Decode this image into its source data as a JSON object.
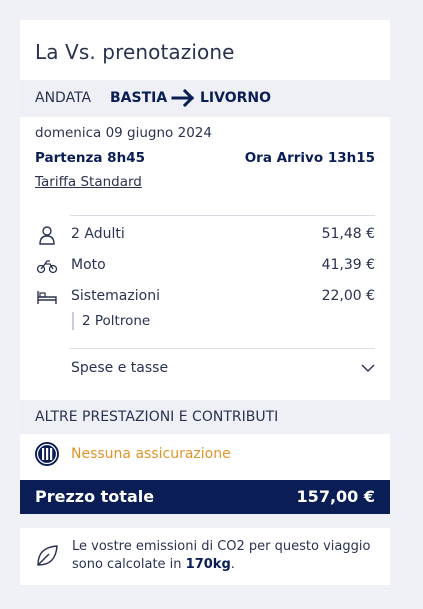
{
  "booking": {
    "title": "La Vs. prenotazione",
    "direction": "ANDATA",
    "from": "BASTIA",
    "to": "LIVORNO",
    "date": "domenica 09 giugno 2024",
    "departure": "Partenza 8h45",
    "arrival": "Ora Arrivo 13h15",
    "fare": "Tariffa Standard"
  },
  "items": [
    {
      "icon": "person-icon",
      "label": "2 Adulti",
      "price": "51,48 €"
    },
    {
      "icon": "motorcycle-icon",
      "label": "Moto",
      "price": "41,39 €"
    },
    {
      "icon": "bed-icon",
      "label": "Sistemazioni",
      "price": "22,00 €"
    }
  ],
  "accommodation_detail": "2 Poltrone",
  "fees_label": "Spese e tasse",
  "extras": {
    "header": "ALTRE PRESTAZIONI E CONTRIBUTI",
    "insurance": "Nessuna assicurazione"
  },
  "total": {
    "label": "Prezzo totale",
    "value": "157,00 €"
  },
  "co2": {
    "text_before": "Le vostre emissioni di CO2 per questo viaggio sono calcolate in ",
    "amount": "170kg",
    "text_after": "."
  },
  "colors": {
    "navy": "#0a1e55",
    "insurance_orange": "#e0962a",
    "band_gray": "#eef0f6"
  }
}
